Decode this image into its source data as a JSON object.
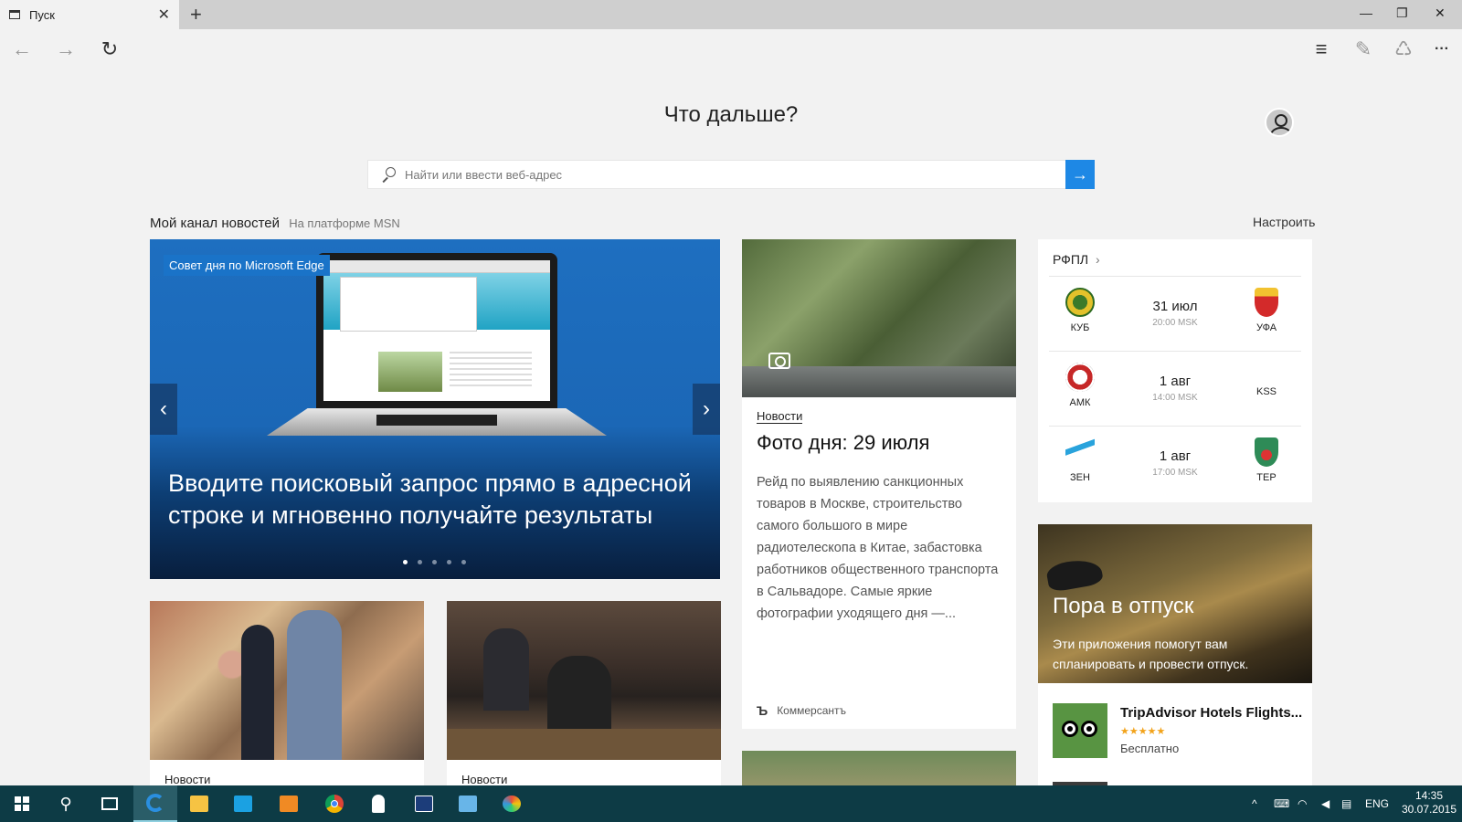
{
  "browser": {
    "tab_title": "Пуск",
    "tab_close": "✕",
    "new_tab": "+",
    "window_controls": {
      "minimize": "—",
      "restore": "❐",
      "close": "✕"
    },
    "nav": {
      "back": "←",
      "forward": "→",
      "refresh": "↻",
      "hub": "≡",
      "note": "✎",
      "share": "♺",
      "more": "···"
    }
  },
  "start": {
    "headline": "Что дальше?",
    "search_placeholder": "Найти или ввести веб-адрес",
    "go_label": "→"
  },
  "feed": {
    "title": "Мой канал новостей",
    "subtitle": "На платформе MSN",
    "customize": "Настроить"
  },
  "hero": {
    "badge": "Совет дня по Microsoft Edge",
    "text": "Вводите поисковый запрос прямо в адресной строке и мгновенно получайте результаты",
    "prev": "‹",
    "next": "›",
    "slides": 5,
    "active_slide": 1
  },
  "news_cards": [
    {
      "category": "Новости"
    },
    {
      "category": "Новости"
    }
  ],
  "photo_card": {
    "category": "Новости",
    "title": "Фото дня: 29 июля",
    "body": "Рейд по выявлению санкционных товаров в Москве, строительство самого большого в мире радиотелескопа в Китае, забастовка работников общественного транспорта в Сальвадоре. Самые яркие фотографии уходящего дня —...",
    "source_logo": "Ъ",
    "source": "Коммерсантъ"
  },
  "sports": {
    "league": "РФПЛ",
    "matches": [
      {
        "home": "КУБ",
        "away": "УФА",
        "date": "31 июл",
        "time": "20:00 MSK"
      },
      {
        "home": "АМК",
        "away": "KSS",
        "date": "1 авг",
        "time": "14:00 MSK"
      },
      {
        "home": "ЗЕН",
        "away": "ТЕР",
        "date": "1 авг",
        "time": "17:00 MSK"
      }
    ]
  },
  "vacation": {
    "title": "Пора в отпуск",
    "text": "Эти приложения помогут вам спланировать и провести отпуск."
  },
  "app": {
    "name": "TripAdvisor Hotels Flights...",
    "stars": "★★★★★",
    "rating_stars": 4.5,
    "price": "Бесплатно"
  },
  "taskbar": {
    "search_glyph": "⚲",
    "language": "ENG",
    "time": "14:35",
    "date": "30.07.2015",
    "tray_chevron": "^"
  },
  "colors": {
    "accent": "#1e88e5",
    "taskbar": "#0d3b45",
    "hero": "#1b67b6"
  }
}
